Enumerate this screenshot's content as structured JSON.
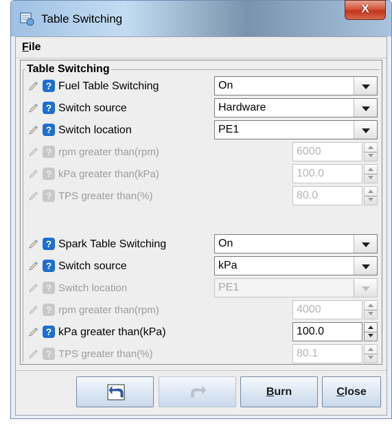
{
  "window": {
    "title": "Table Switching",
    "close_glyph": "X"
  },
  "menu": {
    "file_mnemonic": "F",
    "file_rest": "ile"
  },
  "group": {
    "legend": "Table Switching"
  },
  "rows": [
    {
      "label": "Fuel Table Switching",
      "kind": "combo",
      "value": "On",
      "enabled": true
    },
    {
      "label": "Switch source",
      "kind": "combo",
      "value": "Hardware",
      "enabled": true
    },
    {
      "label": "Switch location",
      "kind": "combo",
      "value": "PE1",
      "enabled": true
    },
    {
      "label": "rpm greater than(rpm)",
      "kind": "spin",
      "value": "6000",
      "enabled": false
    },
    {
      "label": "kPa greater than(kPa)",
      "kind": "spin",
      "value": "100.0",
      "enabled": false
    },
    {
      "label": "TPS greater than(%)",
      "kind": "spin",
      "value": "80.0",
      "enabled": false
    },
    {
      "label": "Spark Table Switching",
      "kind": "combo",
      "value": "On",
      "enabled": true
    },
    {
      "label": "Switch source",
      "kind": "combo",
      "value": "kPa",
      "enabled": true
    },
    {
      "label": "Switch location",
      "kind": "combo",
      "value": "PE1",
      "enabled": false
    },
    {
      "label": "rpm greater than(rpm)",
      "kind": "spin",
      "value": "4000",
      "enabled": false
    },
    {
      "label": "kPa greater than(kPa)",
      "kind": "spin",
      "value": "100.0",
      "enabled": true
    },
    {
      "label": "TPS greater than(%)",
      "kind": "spin",
      "value": "80.1",
      "enabled": false
    }
  ],
  "help_glyph": "?",
  "buttons": {
    "undo_icon": "undo-icon",
    "redo_icon": "redo-icon",
    "burn_mnemonic": "B",
    "burn_rest": "urn",
    "close_mnemonic": "C",
    "close_rest": "lose"
  },
  "colors": {
    "help_blue": "#1d6fd0",
    "disabled_text": "#9c9c9c"
  }
}
